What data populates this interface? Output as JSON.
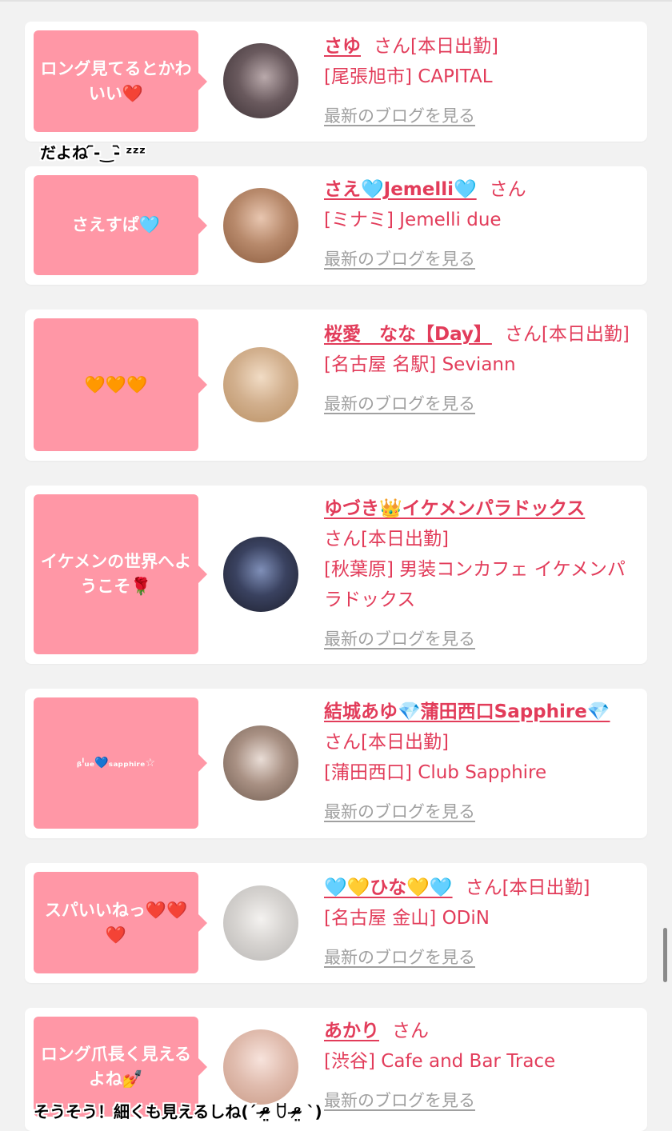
{
  "entries": [
    {
      "comment": "ロング見てるとかわいい❤️",
      "name": "さゆ",
      "suffix": "さん[本日出勤]",
      "shop": "[尾張旭市] CAPITAL",
      "blog": "最新のブログを見る",
      "avatar_colors": [
        "#3a2f33",
        "#b9a9ab"
      ]
    },
    {
      "comment": "さえすぱ🩵",
      "name": "さえ🩵Jemelli🩵",
      "suffix": "さん",
      "shop": "[ミナミ] Jemelli due",
      "blog": "最新のブログを見る",
      "avatar_colors": [
        "#8a5a3c",
        "#e8c6b0"
      ]
    },
    {
      "comment": "🧡🧡🧡",
      "name": "桜愛　なな【Day】",
      "suffix": "さん[本日出勤]",
      "shop": "[名古屋 名駅] Seviann",
      "blog": "最新のブログを見る",
      "avatar_colors": [
        "#b98f62",
        "#f1dcc5"
      ]
    },
    {
      "comment": "イケメンの世界へようこそ🌹",
      "name": "ゆづき👑イケメンパラドックス",
      "suffix": "さん[本日出勤]",
      "shop": "[秋葉原] 男装コンカフェ イケメンパラドックス",
      "blog": "最新のブログを見る",
      "avatar_colors": [
        "#1b1d2a",
        "#7f8fb8"
      ]
    },
    {
      "comment": "ᵦˡᵤₑ💙ₛₐₚₚₕᵢᵣₑ☆",
      "name": "結城あゆ💎蒲田西口Sapphire💎",
      "suffix": "さん[本日出勤]",
      "shop": "[蒲田西口] Club Sapphire",
      "blog": "最新のブログを見る",
      "avatar_colors": [
        "#6e5a4e",
        "#e9ddd6"
      ]
    },
    {
      "comment": "スパいいねっ❤️❤️❤️",
      "name": "🩵💛ひな💛🩵",
      "suffix": "さん[本日出勤]",
      "shop": "[名古屋 金山] ODiN",
      "blog": "最新のブログを見る",
      "avatar_colors": [
        "#b8b6b4",
        "#f4f2f0"
      ]
    },
    {
      "comment": "ロング爪長く見えるよね💅",
      "name": "あかり",
      "suffix": "さん",
      "shop": "[渋谷] Cafe and Bar Trace",
      "blog": "最新のブログを見る",
      "avatar_colors": [
        "#c99a86",
        "#f7e3dc"
      ]
    }
  ],
  "overlays": {
    "top": "だよね ᷇-‿-᷆ ᶻᶻᶻ",
    "bottom": "そうそう！細くも見えるしね(ˊ ᵒ̴̶̷̤ ꇴ ᵒ̴̶̷̤ ˋ)"
  },
  "colors": {
    "background": "#f2f2f2",
    "bubble": "#ff97a6",
    "accent": "#e23c5a",
    "link_gray": "#a0a0a0"
  }
}
